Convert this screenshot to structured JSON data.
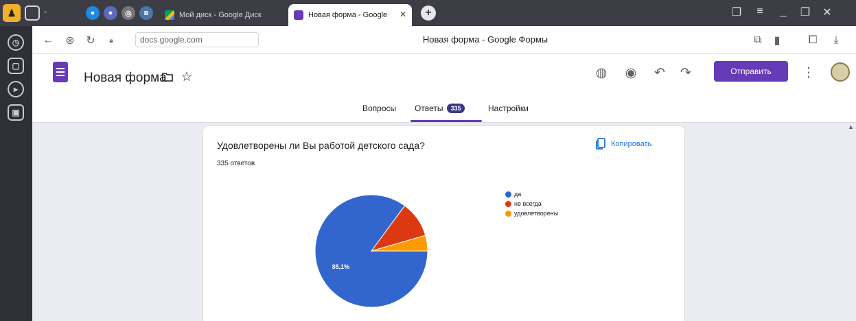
{
  "browser": {
    "tabs": [
      {
        "label": "Мой диск - Google Диск",
        "active": false
      },
      {
        "label": "Новая форма - Google",
        "active": true
      }
    ],
    "url": "docs.google.com",
    "page_title": "Новая форма - Google Формы"
  },
  "form": {
    "title": "Новая форма",
    "send_label": "Отправить",
    "tabs": {
      "questions": "Вопросы",
      "answers": "Ответы",
      "answers_count": "335",
      "settings": "Настройки"
    }
  },
  "card": {
    "question": "Удовлетворены ли Вы работой детского сада?",
    "responses": "335 ответов",
    "copy_label": "Копировать"
  },
  "colors": {
    "accent": "#673ab7",
    "yes": "#3366cc",
    "not_always": "#dc3912",
    "satisfied": "#ff9900"
  },
  "chart_data": {
    "type": "pie",
    "slices": [
      {
        "label": "да",
        "value": 85.1,
        "color": "#3366cc",
        "data_label": "85,1%"
      },
      {
        "label": "не всегда",
        "value": 10.4,
        "color": "#dc3912",
        "data_label": ""
      },
      {
        "label": "удовлетворены",
        "value": 4.5,
        "color": "#ff9900",
        "data_label": ""
      }
    ],
    "legend_position": "right"
  }
}
